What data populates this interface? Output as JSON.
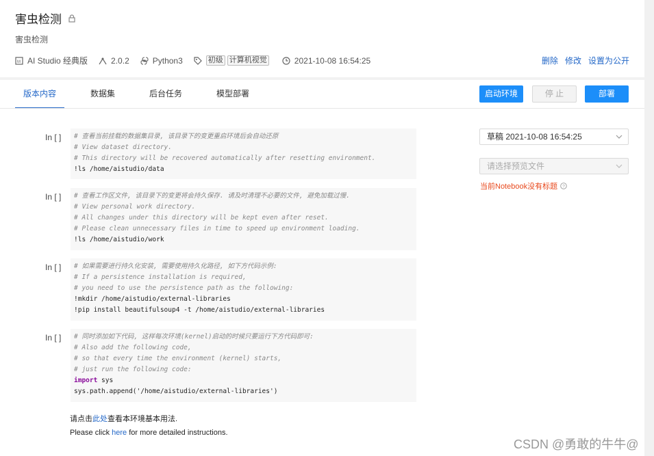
{
  "project": {
    "title": "害虫检测",
    "subtitle": "害虫检测",
    "meta": {
      "platform": "AI Studio 经典版",
      "version": "2.0.2",
      "language": "Python3",
      "tags": [
        "初级",
        "计算机视觉"
      ],
      "datetime": "2021-10-08 16:54:25"
    },
    "actions": {
      "delete": "删除",
      "edit": "修改",
      "make_public": "设置为公开"
    }
  },
  "tabs": [
    "版本内容",
    "数据集",
    "后台任务",
    "模型部署"
  ],
  "buttons": {
    "start_env": "启动环境",
    "stop": "停 止",
    "deploy": "部署"
  },
  "cells": [
    {
      "prompt": "In [ ]",
      "lines": [
        {
          "t": "cm",
          "v": "# 查看当前挂载的数据集目录, 该目录下的变更重启环境后会自动还原"
        },
        {
          "t": "cm",
          "v": "# View dataset directory."
        },
        {
          "t": "cm",
          "v": "# This directory will be recovered automatically after resetting environment."
        },
        {
          "t": "cd",
          "v": "!ls /home/aistudio/data"
        }
      ]
    },
    {
      "prompt": "In [ ]",
      "lines": [
        {
          "t": "cm",
          "v": "# 查看工作区文件, 该目录下的变更将会持久保存. 请及时清理不必要的文件, 避免加载过慢."
        },
        {
          "t": "cm",
          "v": "# View personal work directory."
        },
        {
          "t": "cm",
          "v": "# All changes under this directory will be kept even after reset."
        },
        {
          "t": "cm",
          "v": "# Please clean unnecessary files in time to speed up environment loading."
        },
        {
          "t": "cd",
          "v": "!ls /home/aistudio/work"
        }
      ]
    },
    {
      "prompt": "In [ ]",
      "lines": [
        {
          "t": "cm",
          "v": "# 如果需要进行持久化安装, 需要使用持久化路径, 如下方代码示例:"
        },
        {
          "t": "cm",
          "v": "# If a persistence installation is required,"
        },
        {
          "t": "cm",
          "v": "# you need to use the persistence path as the following:"
        },
        {
          "t": "cd",
          "v": "!mkdir /home/aistudio/external-libraries"
        },
        {
          "t": "cd",
          "v": "!pip install beautifulsoup4 -t /home/aistudio/external-libraries"
        }
      ]
    },
    {
      "prompt": "In [ ]",
      "lines": [
        {
          "t": "cm",
          "v": "# 同时添加如下代码, 这样每次环境(kernel)启动的时候只要运行下方代码即可:"
        },
        {
          "t": "cm",
          "v": "# Also add the following code,"
        },
        {
          "t": "cm",
          "v": "# so that every time the environment (kernel) starts,"
        },
        {
          "t": "cm",
          "v": "# just run the following code:"
        },
        {
          "t": "kw",
          "v": "import",
          "rest": " sys"
        },
        {
          "t": "str",
          "v": "sys.path.append('/home/aistudio/external-libraries')"
        }
      ]
    }
  ],
  "notes": {
    "cn_prefix": "请点击",
    "cn_link": "此处",
    "cn_suffix": "查看本环境基本用法.",
    "en_prefix": "Please click ",
    "en_link": "here",
    "en_suffix": " for more detailed instructions."
  },
  "sidebar": {
    "version_select": "草稿 2021-10-08 16:54:25",
    "preview_placeholder": "请选择预览文件",
    "warning": "当前Notebook没有标题"
  },
  "watermark": "CSDN @勇敢的牛牛@"
}
